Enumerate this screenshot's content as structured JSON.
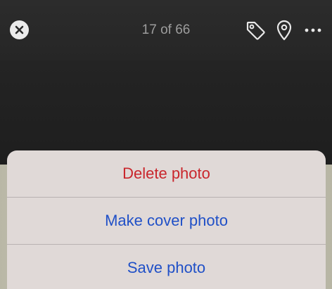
{
  "header": {
    "counter_text": "17 of 66",
    "icons": [
      "close-icon",
      "tag-icon",
      "location-pin-icon",
      "more-icon"
    ]
  },
  "action_sheet": {
    "items": [
      {
        "label": "Delete photo",
        "style": "destructive"
      },
      {
        "label": "Make cover photo",
        "style": "default"
      },
      {
        "label": "Save photo",
        "style": "default"
      }
    ]
  },
  "colors": {
    "destructive": "#c9262c",
    "action": "#2050c7",
    "sheet_background": "#e0d9d7",
    "top_bar_background": "#2a2a2a"
  }
}
